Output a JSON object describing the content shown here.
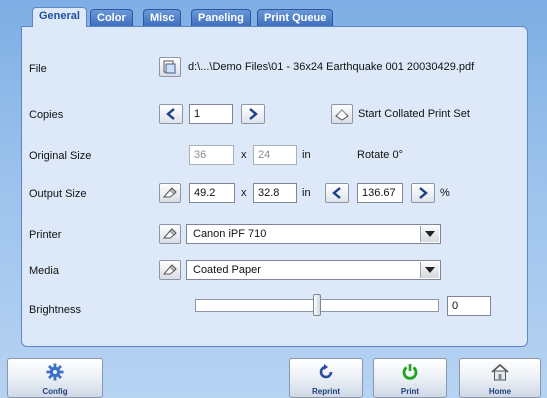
{
  "tabs": [
    "General",
    "Color",
    "Misc",
    "Paneling",
    "Print Queue"
  ],
  "file": {
    "label": "File",
    "path": "d:\\...\\Demo Files\\01 - 36x24 Earthquake 001 20030429.pdf"
  },
  "copies": {
    "label": "Copies",
    "value": "1",
    "collate_label": "Start Collated Print Set"
  },
  "original_size": {
    "label": "Original Size",
    "width": "36",
    "x": "x",
    "height": "24",
    "unit": "in",
    "rotate": "Rotate 0°"
  },
  "output_size": {
    "label": "Output Size",
    "width": "49.2",
    "x": "x",
    "height": "32.8",
    "unit": "in",
    "percent": "136.67",
    "percent_sign": "%"
  },
  "printer": {
    "label": "Printer",
    "value": "Canon iPF 710"
  },
  "media": {
    "label": "Media",
    "value": "Coated Paper"
  },
  "brightness": {
    "label": "Brightness",
    "value": "0",
    "level": 0.5
  },
  "bottom_buttons": {
    "config": "Config",
    "reprint": "Reprint",
    "print": "Print",
    "home": "Home"
  },
  "colors": {
    "accent": "#3f6fbe",
    "panel": "#dde9f8",
    "print_green": "#1fa51f",
    "reprint_blue": "#2b4f9a"
  }
}
